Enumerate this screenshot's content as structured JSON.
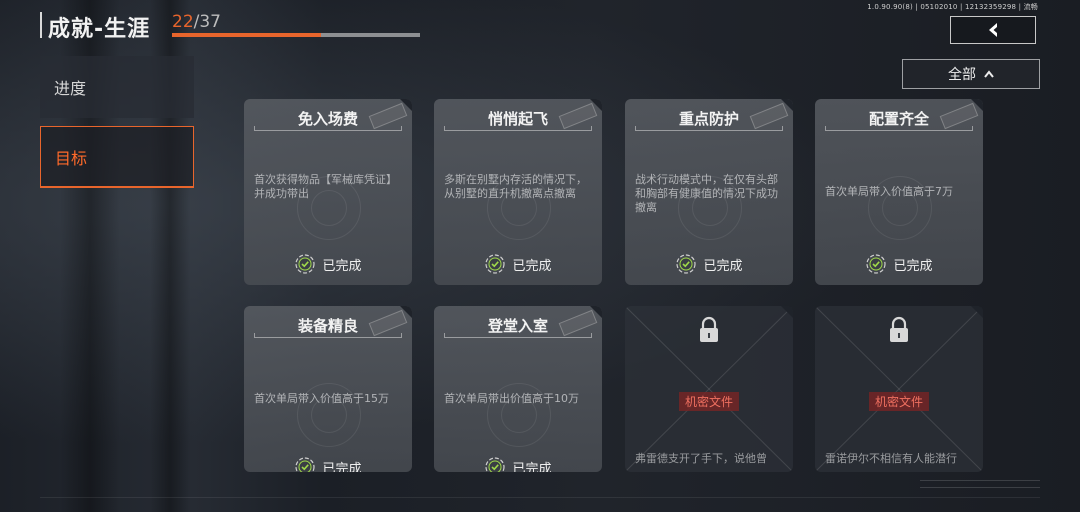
{
  "version_text": "1.0.90.90(8) | 05102010 | 12132359298 | 流畅",
  "header": {
    "title": "成就-生涯",
    "progress_current": "22",
    "progress_total": "/37",
    "progress_fraction": 0.6
  },
  "back_icon": "chevron-left-icon",
  "sidebar": {
    "items": [
      {
        "label": "进度",
        "active": false
      },
      {
        "label": "目标",
        "active": true
      }
    ]
  },
  "filter": {
    "label": "全部",
    "icon": "chevron-up-icon"
  },
  "cards": [
    {
      "title": "免入场费",
      "desc": "首次获得物品【军械库凭证】并成功带出",
      "status": "已完成"
    },
    {
      "title": "悄悄起飞",
      "desc": "多斯在别墅内存活的情况下，从别墅的直升机撤离点撤离",
      "status": "已完成"
    },
    {
      "title": "重点防护",
      "desc": "战术行动模式中，在仅有头部和胸部有健康值的情况下成功撤离",
      "status": "已完成"
    },
    {
      "title": "配置齐全",
      "desc": "首次单局带入价值高于7万",
      "status": "已完成"
    },
    {
      "title": "装备精良",
      "desc": "首次单局带入价值高于15万",
      "status": "已完成"
    },
    {
      "title": "登堂入室",
      "desc": "首次单局带出价值高于10万",
      "status": "已完成"
    },
    {
      "classified_label": "机密文件",
      "desc": "弗雷德支开了手下，说他曾",
      "icon": "lock-icon"
    },
    {
      "classified_label": "机密文件",
      "desc": "雷诺伊尔不相信有人能潜行",
      "icon": "lock-icon"
    }
  ],
  "colors": {
    "accent": "#e8652c",
    "check": "#9fd84a"
  }
}
